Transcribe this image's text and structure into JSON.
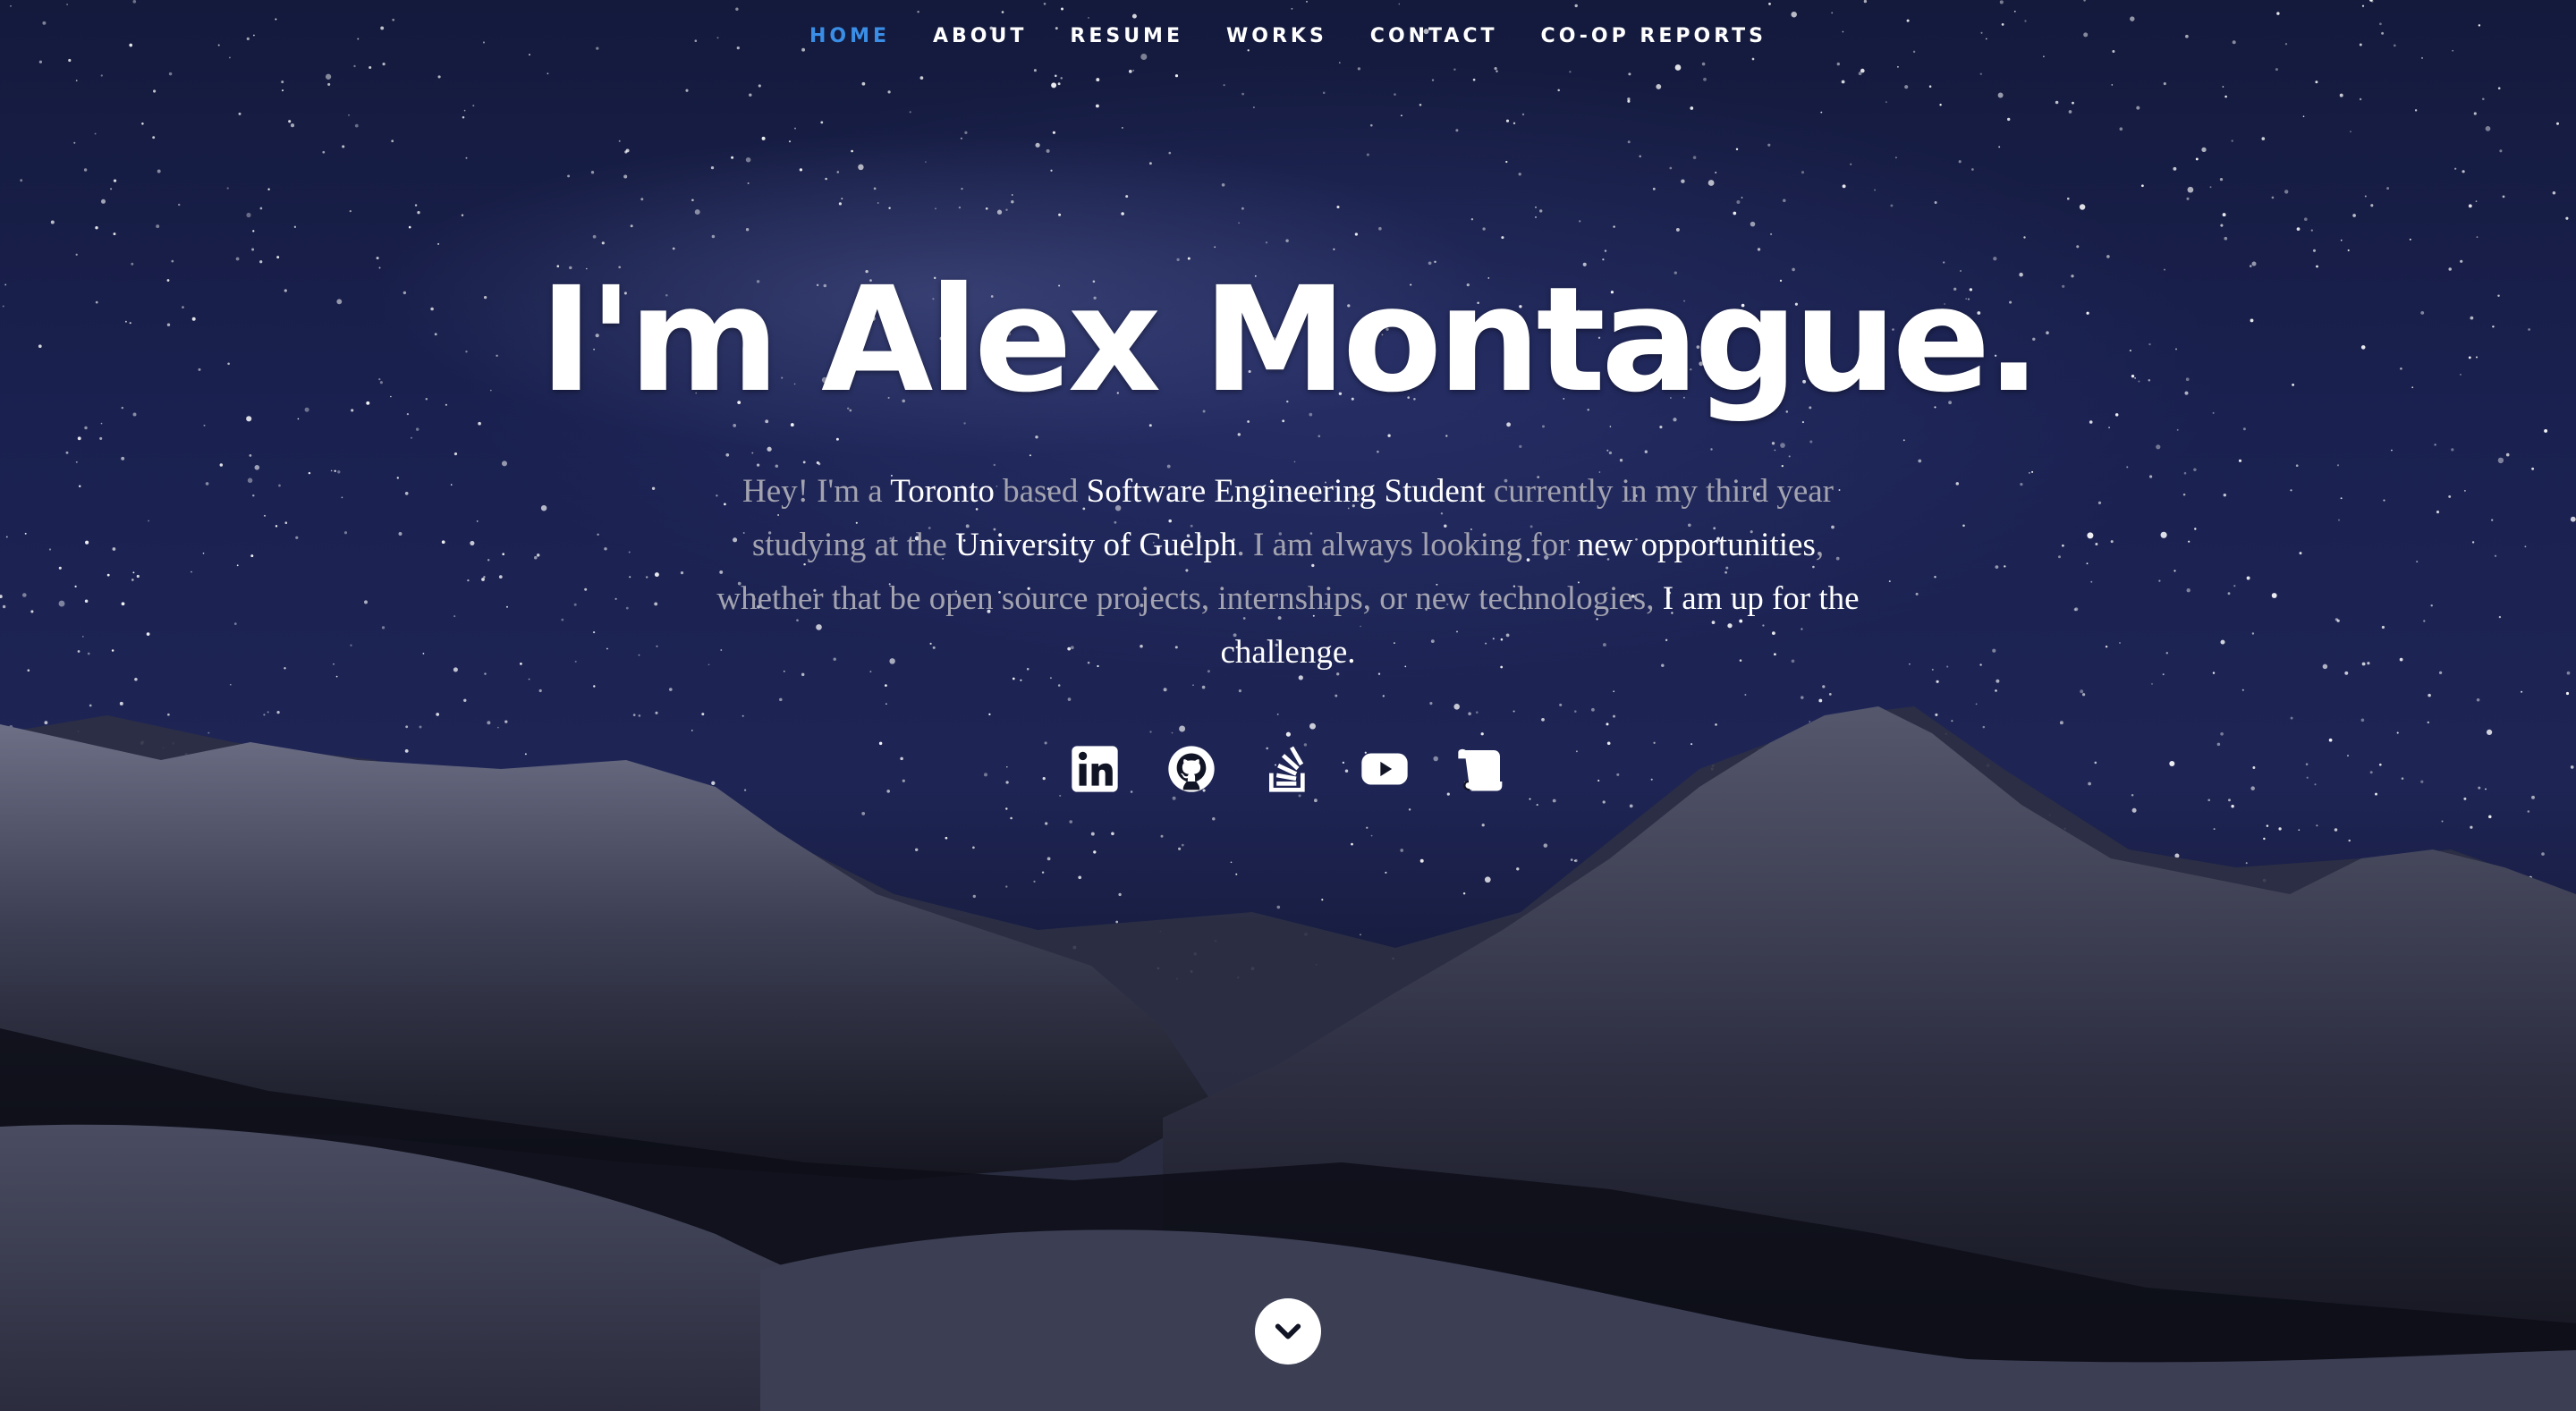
{
  "nav": {
    "items": [
      {
        "label": "HOME",
        "active": true
      },
      {
        "label": "ABOUT",
        "active": false
      },
      {
        "label": "RESUME",
        "active": false
      },
      {
        "label": "WORKS",
        "active": false
      },
      {
        "label": "CONTACT",
        "active": false
      },
      {
        "label": "CO-OP REPORTS",
        "active": false
      }
    ]
  },
  "hero": {
    "headline": "I'm Alex Montague.",
    "intro": {
      "t1": "Hey! I'm a ",
      "h1": "Toronto",
      "t2": " based ",
      "h2": "Software Engineering Student",
      "t3": " currently in my third year studying at the ",
      "h3": "University of Guelph",
      "t4": ". I am always looking for ",
      "h4": "new opportunities",
      "t5": ", whether that be open source projects, internships, or new technologies, ",
      "h5": "I am up for the challenge."
    }
  },
  "social": [
    {
      "icon": "linkedin-icon"
    },
    {
      "icon": "github-icon"
    },
    {
      "icon": "stack-overflow-icon"
    },
    {
      "icon": "youtube-icon"
    },
    {
      "icon": "scroll-icon"
    }
  ],
  "scroll_down": {
    "icon": "chevron-down-icon"
  },
  "colors": {
    "accent": "#3a8ee6",
    "text": "#ffffff",
    "muted": "#a3a3b0",
    "sky": "#1a2150"
  }
}
